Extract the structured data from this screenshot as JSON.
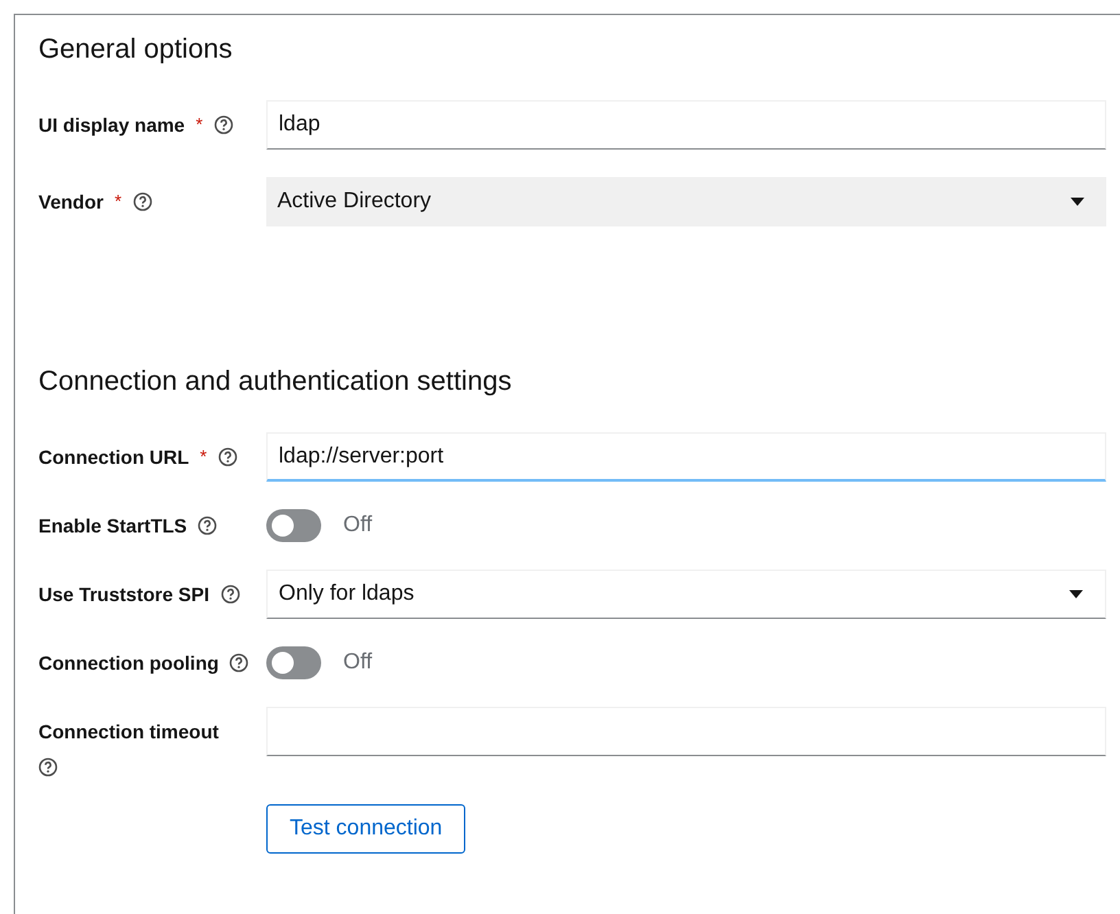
{
  "sections": [
    {
      "title": "General options",
      "fields": [
        {
          "kind": "text",
          "label": "UI display name",
          "required_mark": "*",
          "value": "ldap",
          "focused": false
        },
        {
          "kind": "select",
          "label": "Vendor",
          "required_mark": "*",
          "value": "Active Directory",
          "disabled": true
        }
      ]
    },
    {
      "title": "Connection and authentication settings",
      "fields": [
        {
          "kind": "text",
          "label": "Connection URL",
          "required_mark": "*",
          "value": "ldap://server:port",
          "focused": true
        },
        {
          "kind": "switch",
          "label": "Enable StartTLS",
          "on": false,
          "state_text": "Off"
        },
        {
          "kind": "select",
          "label": "Use Truststore SPI",
          "value": "Only for ldaps",
          "disabled": false
        },
        {
          "kind": "switch",
          "label": "Connection pooling",
          "on": false,
          "state_text": "Off"
        },
        {
          "kind": "text",
          "label": "Connection timeout",
          "focused": false,
          "wrap": true
        }
      ]
    }
  ],
  "action": {
    "label": "Test connection"
  }
}
